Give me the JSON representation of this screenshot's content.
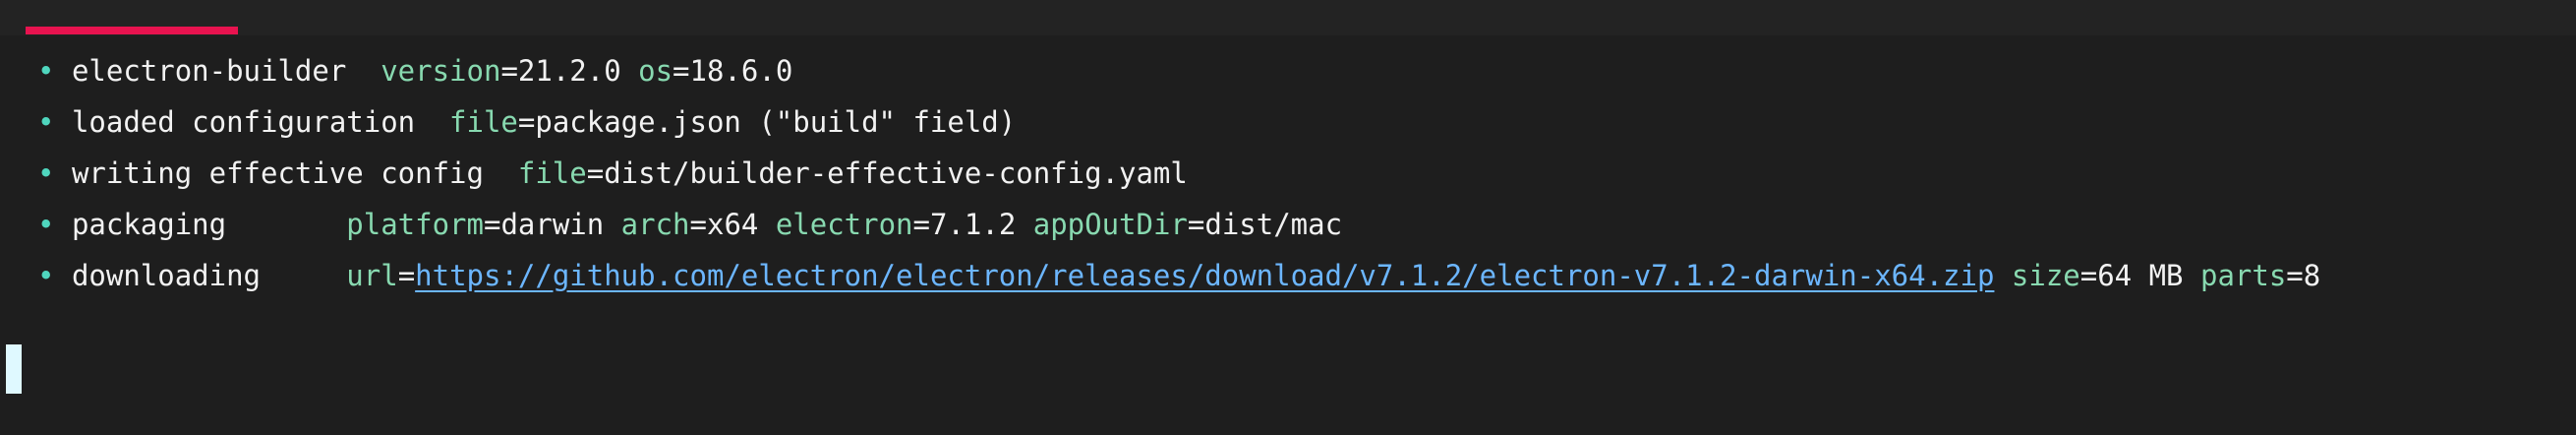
{
  "colors": {
    "background": "#1e1e1e",
    "tab_indicator": "#e8134f",
    "bullet": "#4fd6be",
    "key": "#88d9b0",
    "text": "#f2f2f2",
    "link": "#6cb6ff",
    "cursor": "#dff9ff"
  },
  "bullet_symbol": "•",
  "lines": [
    {
      "message": "electron-builder  ",
      "fields": [
        {
          "key": "version",
          "value": "21.2.0 "
        },
        {
          "key": "os",
          "value": "18.6.0"
        }
      ]
    },
    {
      "message": "loaded configuration  ",
      "fields": [
        {
          "key": "file",
          "value": "package.json (\"build\" field)"
        }
      ]
    },
    {
      "message": "writing effective config  ",
      "fields": [
        {
          "key": "file",
          "value": "dist/builder-effective-config.yaml"
        }
      ]
    },
    {
      "message": "packaging       ",
      "fields": [
        {
          "key": "platform",
          "value": "darwin "
        },
        {
          "key": "arch",
          "value": "x64 "
        },
        {
          "key": "electron",
          "value": "7.1.2 "
        },
        {
          "key": "appOutDir",
          "value": "dist/mac"
        }
      ]
    },
    {
      "message": "downloading     ",
      "url_key": "url",
      "url": "https://github.com/electron/electron/releases/download/v7.1.2/electron-v7.1.2-darwin-x64.zip",
      "fields": [
        {
          "key": "size",
          "value": "64 MB "
        },
        {
          "key": "parts",
          "value": "8"
        }
      ]
    }
  ]
}
